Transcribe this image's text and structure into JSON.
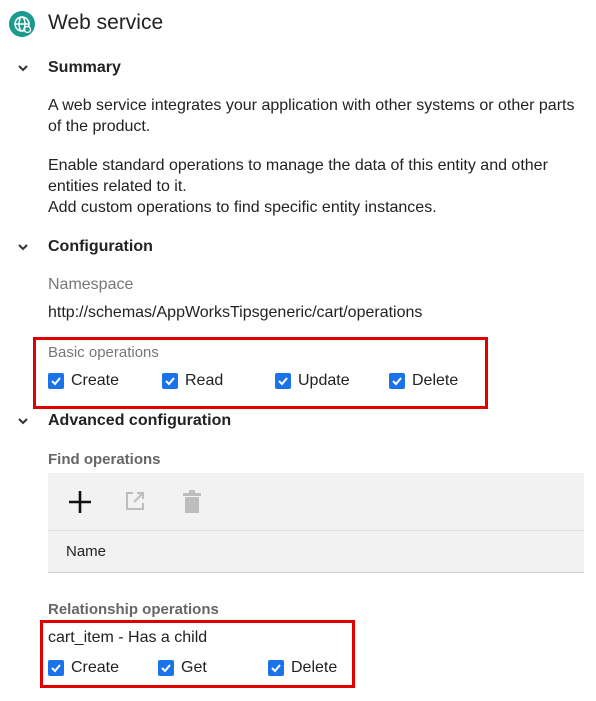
{
  "header": {
    "title": "Web service"
  },
  "summary": {
    "title": "Summary",
    "para1": "A web service integrates your application with other systems or other parts of the product.",
    "para2a": "Enable standard operations to manage the data of this entity and other entities related to it.",
    "para2b": "Add custom operations to find specific entity instances."
  },
  "configuration": {
    "title": "Configuration",
    "namespace_label": "Namespace",
    "namespace_value": "http://schemas/AppWorksTipsgeneric/cart/operations",
    "basic_label": "Basic operations",
    "basic_ops": [
      "Create",
      "Read",
      "Update",
      "Delete"
    ]
  },
  "advanced": {
    "title": "Advanced configuration",
    "find_label": "Find operations",
    "table_header": "Name",
    "relationship_label": "Relationship operations",
    "relationship_name": "cart_item - Has a child",
    "relationship_ops": [
      "Create",
      "Get",
      "Delete"
    ]
  },
  "colors": {
    "accent": "#1a73e8",
    "highlight": "#e00000",
    "icon_bg": "#1a9b8e"
  }
}
